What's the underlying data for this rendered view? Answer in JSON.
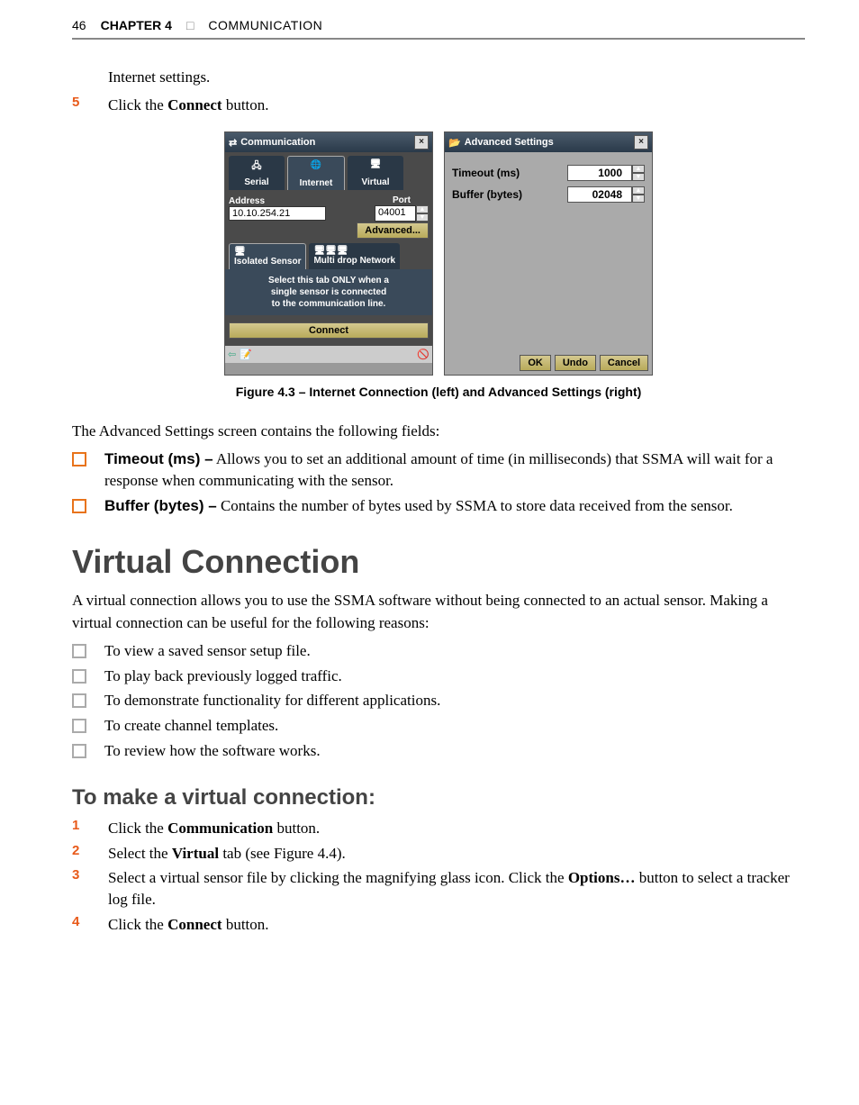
{
  "header": {
    "page_number": "46",
    "chapter_label": "CHAPTER 4",
    "separator": "□",
    "chapter_title": "COMMUNICATION"
  },
  "intro": {
    "l1": "Internet settings.",
    "step5_num": "5",
    "step5_a": "Click the ",
    "step5_b": "Connect",
    "step5_c": " button."
  },
  "dialog1": {
    "title": "Communication",
    "tab_serial": "Serial",
    "tab_internet": "Internet",
    "tab_virtual": "Virtual",
    "address_label": "Address",
    "address_value": "10.10.254.21",
    "port_label": "Port",
    "port_value": "04001",
    "advanced_btn": "Advanced...",
    "tab_isolated": "Isolated Sensor",
    "tab_multi": "Multi drop Network",
    "note_l1": "Select this tab ONLY when a",
    "note_l2": "single sensor is connected",
    "note_l3": "to the communication line.",
    "connect_btn": "Connect"
  },
  "dialog2": {
    "title": "Advanced Settings",
    "timeout_label": "Timeout (ms)",
    "timeout_value": "1000",
    "buffer_label": "Buffer (bytes)",
    "buffer_value": "02048",
    "ok": "OK",
    "undo": "Undo",
    "cancel": "Cancel"
  },
  "figure_caption": "Figure 4.3 – Internet Connection (left) and Advanced Settings (right)",
  "adv_intro": "The Advanced Settings screen contains the following fields:",
  "adv_items": {
    "timeout_b": "Timeout (ms) –",
    "timeout_t": " Allows you to set an additional amount of time (in milliseconds) that SSMA will wait for a response when communicating with the sensor.",
    "buffer_b": "Buffer (bytes) –",
    "buffer_t": " Contains the number of bytes used by SSMA to store data received from the sensor."
  },
  "section": {
    "title": "Virtual Connection",
    "p": "A virtual connection allows you to use the SSMA software without being connected to an actual sensor. Making a virtual connection can be useful for the following reasons:",
    "b1": "To view a saved sensor setup file.",
    "b2": "To play back previously logged traffic.",
    "b3": "To demonstrate functionality for different applications.",
    "b4": "To create channel templates.",
    "b5": "To review how the software works."
  },
  "subsection": {
    "title": "To make a virtual connection:",
    "s1_n": "1",
    "s1_a": "Click the ",
    "s1_b": "Communication",
    "s1_c": " button.",
    "s2_n": "2",
    "s2_a": "Select the ",
    "s2_b": "Virtual",
    "s2_c": " tab (see Figure 4.4).",
    "s3_n": "3",
    "s3_a": "Select a virtual sensor file by clicking the magnifying glass icon. Click the ",
    "s3_b": "Options…",
    "s3_c": " button to select a tracker log file.",
    "s4_n": "4",
    "s4_a": "Click the ",
    "s4_b": "Connect",
    "s4_c": " button."
  }
}
